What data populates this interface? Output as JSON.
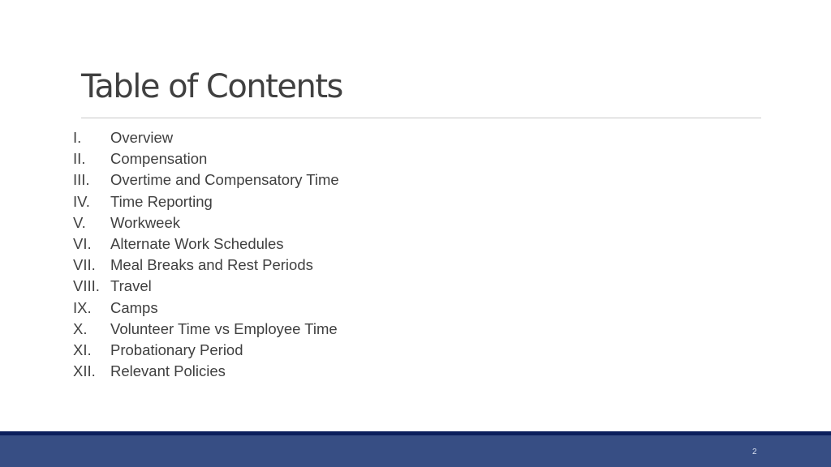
{
  "slide": {
    "title": "Table of Contents",
    "page_number": "2",
    "colors": {
      "title_text": "#404040",
      "footer_band": "#374e84",
      "footer_stripe": "#0b1f5c",
      "rule": "#c8c8c8"
    }
  },
  "toc": [
    {
      "num": "I.",
      "label": "Overview"
    },
    {
      "num": "II.",
      "label": "Compensation"
    },
    {
      "num": "III.",
      "label": "Overtime and Compensatory Time"
    },
    {
      "num": "IV.",
      "label": "Time Reporting"
    },
    {
      "num": "V.",
      "label": "Workweek"
    },
    {
      "num": "VI.",
      "label": "Alternate Work Schedules"
    },
    {
      "num": "VII.",
      "label": "Meal Breaks and Rest Periods"
    },
    {
      "num": "VIII.",
      "label": "Travel"
    },
    {
      "num": "IX.",
      "label": "Camps"
    },
    {
      "num": "X.",
      "label": "Volunteer Time vs Employee Time"
    },
    {
      "num": "XI.",
      "label": "Probationary Period"
    },
    {
      "num": "XII.",
      "label": "Relevant Policies"
    }
  ]
}
